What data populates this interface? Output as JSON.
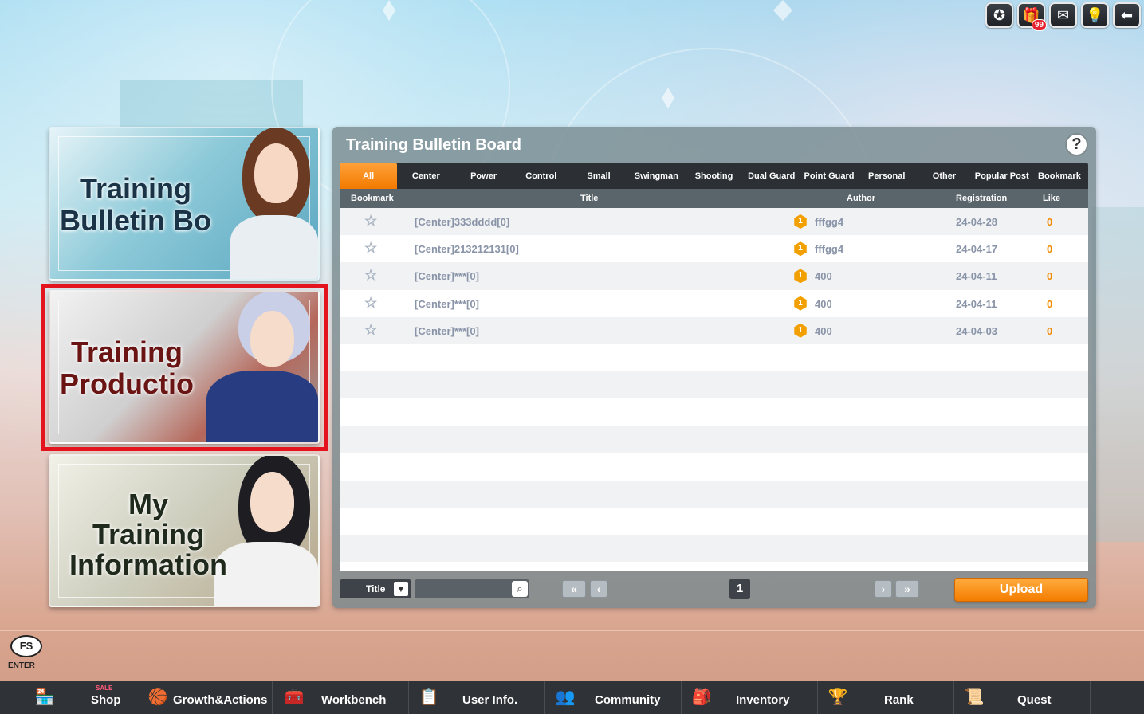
{
  "top_icons": [
    {
      "name": "medal-icon",
      "glyph": "✪"
    },
    {
      "name": "gift-icon",
      "glyph": "🎁",
      "badge": "99"
    },
    {
      "name": "mail-icon",
      "glyph": "✉"
    },
    {
      "name": "lightbulb-icon",
      "glyph": "💡"
    },
    {
      "name": "back-arrow-icon",
      "glyph": "⬅"
    }
  ],
  "cards": {
    "training_bulletin": {
      "line1": "Training",
      "line2": "Bulletin Bo"
    },
    "training_production": {
      "line1": "Training",
      "line2": "Productio"
    },
    "my_training_info": {
      "line1": "My",
      "line2": "Training",
      "line3": "Information"
    }
  },
  "board": {
    "title": "Training Bulletin Board",
    "help": "?",
    "tabs": [
      "All",
      "Center",
      "Power",
      "Control",
      "Small",
      "Swingman",
      "Shooting",
      "Dual Guard",
      "Point Guard",
      "Personal",
      "Other",
      "Popular Post",
      "Bookmark"
    ],
    "active_tab": "All",
    "columns": {
      "bookmark": "Bookmark",
      "title": "Title",
      "author": "Author",
      "registration": "Registration",
      "like": "Like"
    },
    "rows": [
      {
        "title": "[Center]333dddd[0]",
        "level": "1",
        "author": "fffgg4",
        "date": "24-04-28",
        "like": "0"
      },
      {
        "title": "[Center]213212131[0]",
        "level": "1",
        "author": "fffgg4",
        "date": "24-04-17",
        "like": "0"
      },
      {
        "title": "[Center]***[0]",
        "level": "1",
        "author": "400",
        "date": "24-04-11",
        "like": "0"
      },
      {
        "title": "[Center]***[0]",
        "level": "1",
        "author": "400",
        "date": "24-04-11",
        "like": "0"
      },
      {
        "title": "[Center]***[0]",
        "level": "1",
        "author": "400",
        "date": "24-04-03",
        "like": "0"
      }
    ],
    "search_type": "Title",
    "search_placeholder": "",
    "page": "1",
    "upload_label": "Upload"
  },
  "fs_enter": {
    "logo": "FS",
    "label": "ENTER"
  },
  "bottom_nav": [
    {
      "label": "Shop",
      "icon": "🏪",
      "sale": "SALE"
    },
    {
      "label": "Growth&Actions",
      "icon": "🏀"
    },
    {
      "label": "Workbench",
      "icon": "🧰"
    },
    {
      "label": "User Info.",
      "icon": "📋"
    },
    {
      "label": "Community",
      "icon": "👥"
    },
    {
      "label": "Inventory",
      "icon": "🎒"
    },
    {
      "label": "Rank",
      "icon": "🏆"
    },
    {
      "label": "Quest",
      "icon": "📜"
    }
  ]
}
